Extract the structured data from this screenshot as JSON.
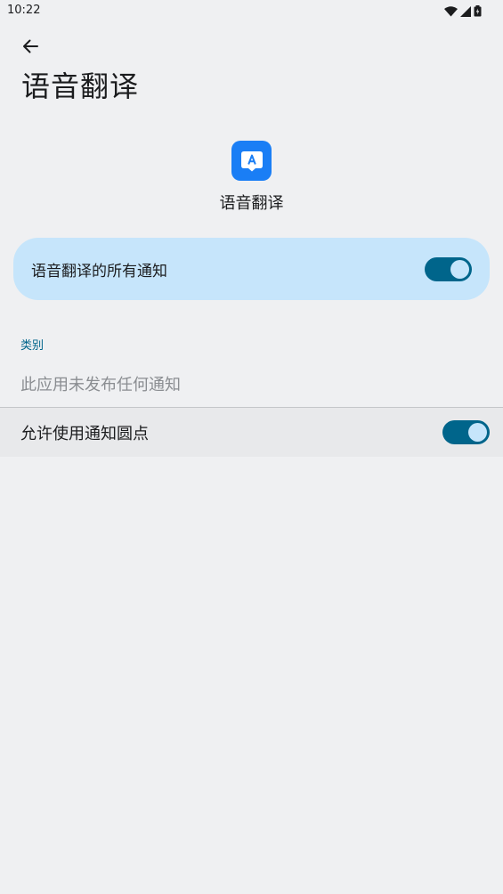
{
  "status_bar": {
    "time": "10:22",
    "icons": [
      "wifi-icon",
      "cell-signal-icon",
      "battery-icon"
    ]
  },
  "header": {
    "back_icon": "arrow-back-icon",
    "title": "语音翻译"
  },
  "app": {
    "icon": "translate-app-icon",
    "icon_color": "#1a7ef5",
    "name": "语音翻译"
  },
  "all_notifications": {
    "label": "语音翻译的所有通知",
    "enabled": true,
    "card_color": "#c6e5fb",
    "accent_color": "#00658b"
  },
  "categories": {
    "header": "类别",
    "empty_text": "此应用未发布任何通知"
  },
  "notification_dots": {
    "label": "允许使用通知圆点",
    "enabled": true
  }
}
